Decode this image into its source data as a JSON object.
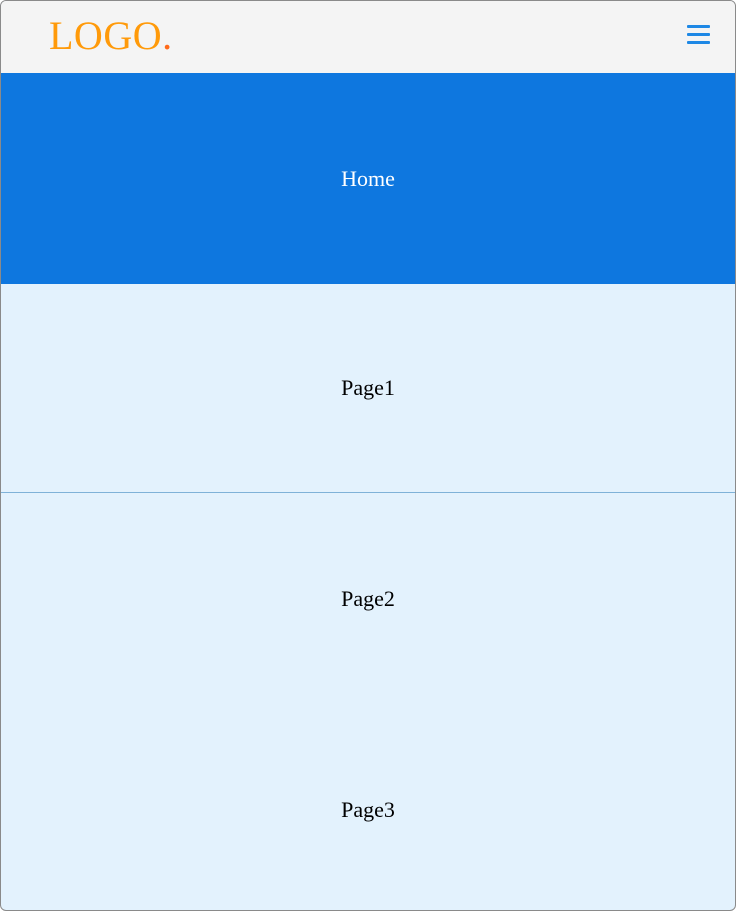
{
  "header": {
    "logo_text": "LOGO",
    "logo_dot": ".",
    "menu_icon": "hamburger-menu-icon"
  },
  "nav": {
    "items": [
      {
        "label": "Home",
        "active": true
      },
      {
        "label": "Page1",
        "active": false
      },
      {
        "label": "Page2",
        "active": false
      },
      {
        "label": "Page3",
        "active": false
      }
    ]
  },
  "colors": {
    "header_bg": "#f4f4f4",
    "logo_orange": "#ff9a0a",
    "menu_blue": "#1e88e5",
    "active_bg": "#0e77df",
    "item_bg": "#e3f2fd"
  }
}
